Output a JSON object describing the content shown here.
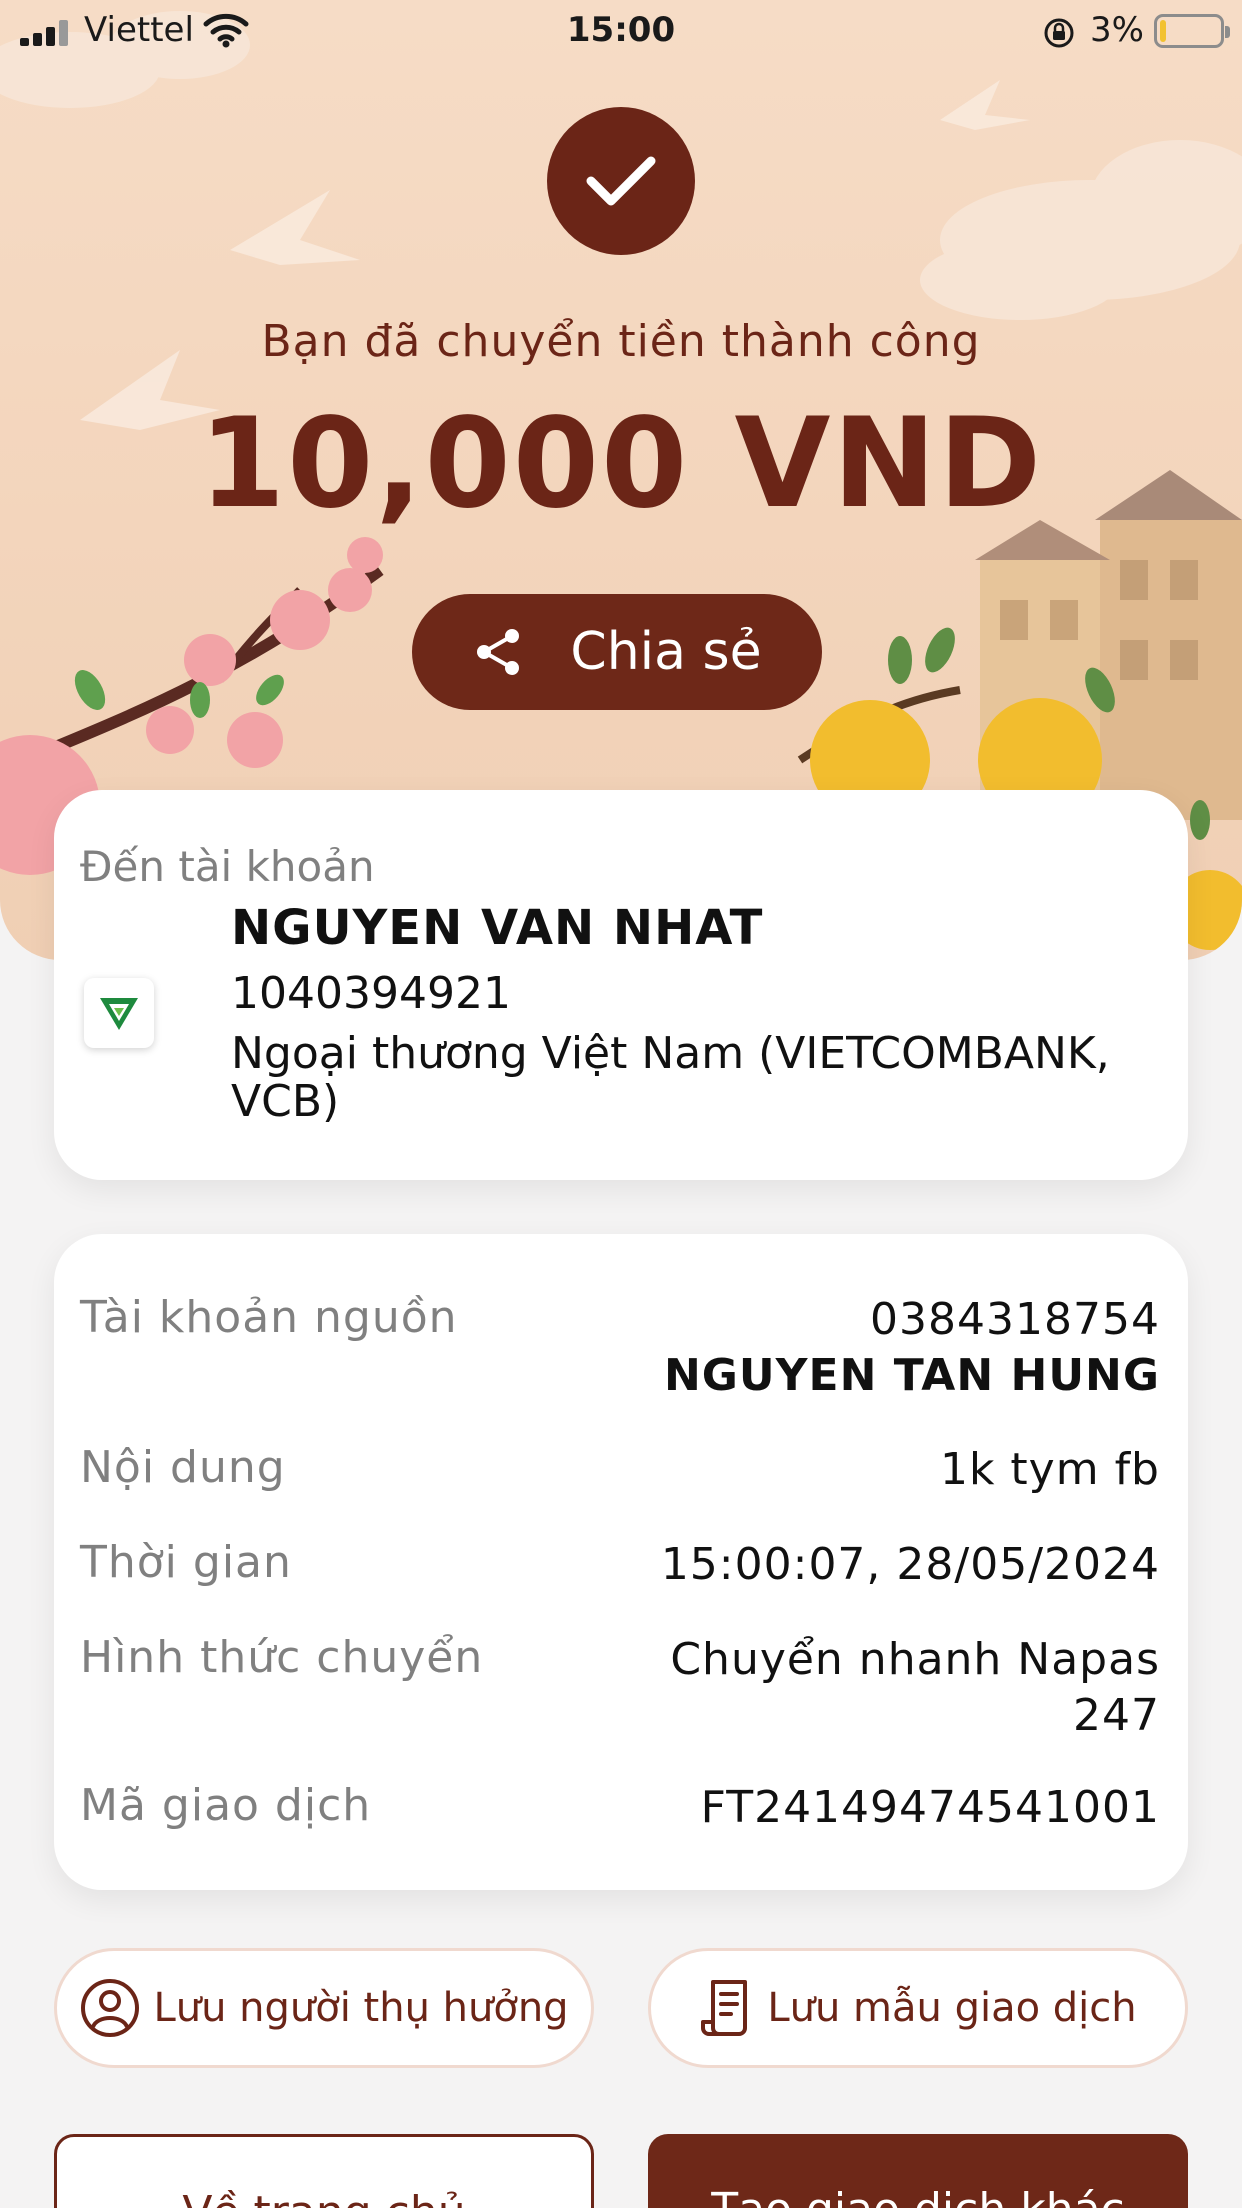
{
  "status_bar": {
    "carrier": "Viettel",
    "time": "15:00",
    "battery_percent": "3%"
  },
  "icons": {
    "check": "check-icon",
    "share": "share-icon",
    "bank_logo": "vietcombank-logo",
    "user": "user-circle-icon",
    "receipt": "receipt-icon"
  },
  "colors": {
    "brand": "#6b2517",
    "hero_bg": "#f3d5bc",
    "card_bg": "#ffffff"
  },
  "header": {
    "success_message": "Bạn đã chuyển tiền thành công",
    "amount": "10,000 VND",
    "share_label": "Chia sẻ"
  },
  "destination": {
    "label": "Đến tài khoản",
    "name": "NGUYEN VAN NHAT",
    "account_number": "1040394921",
    "bank_name": "Ngoại thương Việt Nam (VIETCOMBANK, VCB)"
  },
  "details": {
    "source_label": "Tài khoản nguồn",
    "source_account": "0384318754",
    "source_name": "NGUYEN TAN HUNG",
    "content_label": "Nội dung",
    "content_value": "1k tym fb",
    "time_label": "Thời gian",
    "time_value": "15:00:07, 28/05/2024",
    "method_label": "Hình thức chuyển",
    "method_line1": "Chuyển nhanh Napas",
    "method_line2": "247",
    "txn_label": "Mã giao dịch",
    "txn_value": "FT24149474541001"
  },
  "actions": {
    "save_beneficiary": "Lưu người thụ hưởng",
    "save_template": "Lưu mẫu giao dịch",
    "home": "Về trang chủ",
    "new_transaction": "Tạo giao dịch khác"
  }
}
